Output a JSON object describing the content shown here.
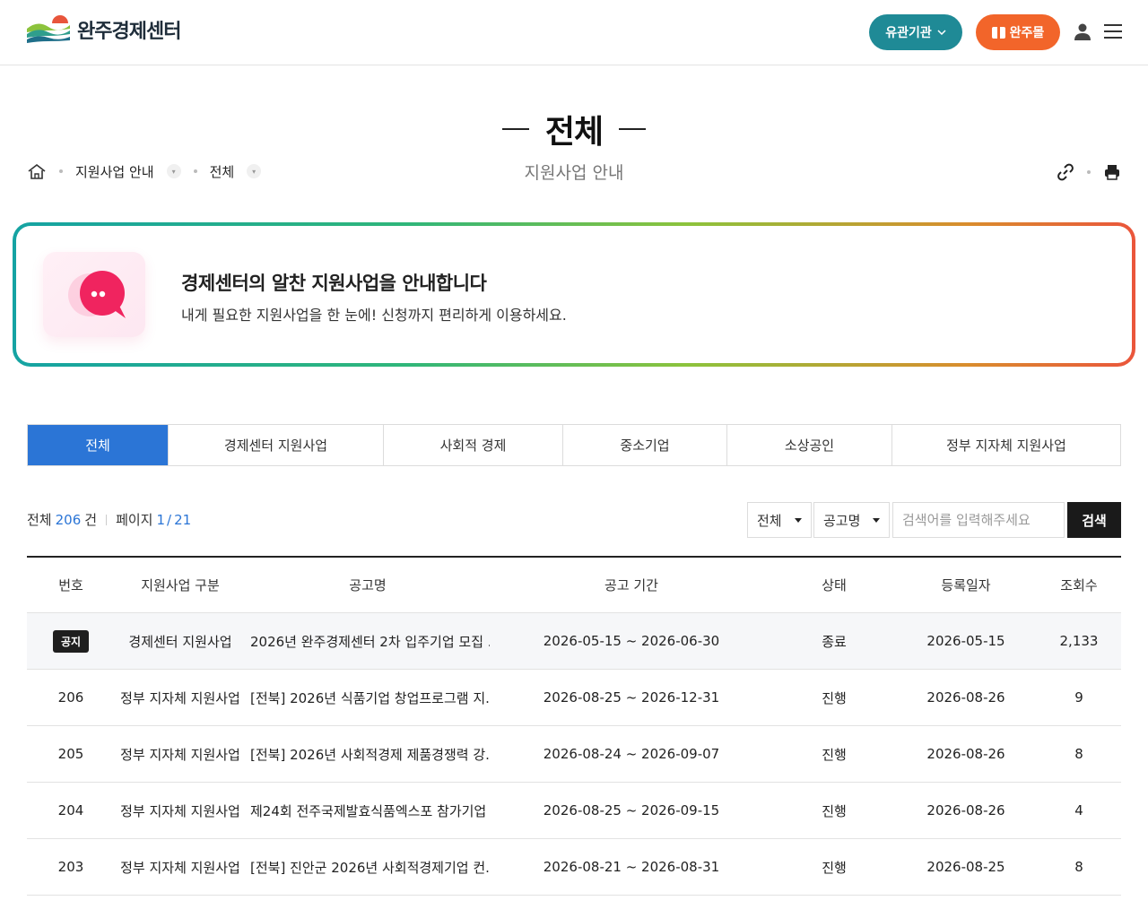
{
  "header": {
    "logo_text": "완주경제센터",
    "org_button": "유관기관",
    "mall_button": "완주몰"
  },
  "page": {
    "title": "전체",
    "subtitle": "지원사업 안내"
  },
  "breadcrumb": {
    "level1": "지원사업 안내",
    "level2": "전체"
  },
  "banner": {
    "title": "경제센터의 알찬 지원사업을 안내합니다",
    "description": "내게 필요한 지원사업을 한 눈에! 신청까지 편리하게 이용하세요."
  },
  "tabs": [
    {
      "label": "전체",
      "active": true
    },
    {
      "label": "경제센터 지원사업",
      "active": false
    },
    {
      "label": "사회적 경제",
      "active": false
    },
    {
      "label": "중소기업",
      "active": false
    },
    {
      "label": "소상공인",
      "active": false
    },
    {
      "label": "정부 지자체 지원사업",
      "active": false
    }
  ],
  "summary": {
    "total_label": "전체",
    "total_count": "206",
    "total_unit": "건",
    "page_label": "페이지",
    "page_current": "1",
    "page_sep": "/",
    "page_total": "21"
  },
  "search": {
    "filter1": "전체",
    "filter2": "공고명",
    "placeholder": "검색어를 입력해주세요",
    "button": "검색"
  },
  "table": {
    "headers": [
      "번호",
      "지원사업 구분",
      "공고명",
      "공고 기간",
      "상태",
      "등록일자",
      "조회수"
    ],
    "rows": [
      {
        "num": "공지",
        "category": "경제센터 지원사업",
        "title": "2026년 완주경제센터 2차 입주기업 모집 ...",
        "period": "2026-05-15 ~ 2026-06-30",
        "status": "종료",
        "date": "2026-05-15",
        "views": "2,133"
      },
      {
        "num": "206",
        "category": "정부 지자체 지원사업",
        "title": "[전북] 2026년 식품기업 창업프로그램 지...",
        "period": "2026-08-25 ~ 2026-12-31",
        "status": "진행",
        "date": "2026-08-26",
        "views": "9"
      },
      {
        "num": "205",
        "category": "정부 지자체 지원사업",
        "title": "[전북] 2026년 사회적경제 제품경쟁력 강...",
        "period": "2026-08-24 ~ 2026-09-07",
        "status": "진행",
        "date": "2026-08-26",
        "views": "8"
      },
      {
        "num": "204",
        "category": "정부 지자체 지원사업",
        "title": "제24회 전주국제발효식품엑스포 참가기업 ...",
        "period": "2026-08-25 ~ 2026-09-15",
        "status": "진행",
        "date": "2026-08-26",
        "views": "4"
      },
      {
        "num": "203",
        "category": "정부 지자체 지원사업",
        "title": "[전북] 진안군 2026년 사회적경제기업 컨...",
        "period": "2026-08-21 ~ 2026-08-31",
        "status": "진행",
        "date": "2026-08-25",
        "views": "8"
      }
    ]
  }
}
